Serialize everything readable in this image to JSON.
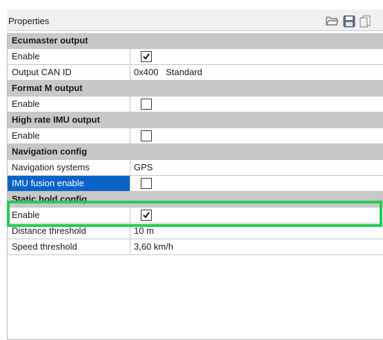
{
  "header": {
    "title": "Properties"
  },
  "toolbar": {
    "open_icon": "folder-open-icon",
    "save_icon": "save-icon",
    "copy_icon": "copy-icon"
  },
  "sections": {
    "ecumaster": {
      "label": "Ecumaster output"
    },
    "formatm": {
      "label": "Format M output"
    },
    "highrate": {
      "label": "High rate IMU output"
    },
    "navconfig": {
      "label": "Navigation config"
    },
    "statichold": {
      "label": "Static hold config"
    }
  },
  "props": {
    "ecu_enable": {
      "label": "Enable",
      "checked": true
    },
    "ecu_canid": {
      "label": "Output CAN ID",
      "value": "0x400   Standard"
    },
    "formatm_enable": {
      "label": "Enable",
      "checked": false
    },
    "highrate_enable": {
      "label": "Enable",
      "checked": false
    },
    "nav_systems": {
      "label": "Navigation systems",
      "value": "GPS"
    },
    "imu_fusion": {
      "label": "IMU fusion enable",
      "checked": false
    },
    "static_enable": {
      "label": "Enable",
      "checked": true
    },
    "distance": {
      "label": "Distance threshold",
      "value": "10 m"
    },
    "speed": {
      "label": "Speed threshold",
      "value": "3,60 km/h"
    }
  },
  "colors": {
    "section_bg": "#c8c8c8",
    "selected_bg": "#0a64c8",
    "highlight": "#22cc55"
  }
}
